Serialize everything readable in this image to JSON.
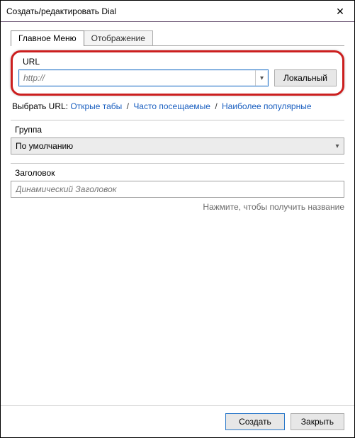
{
  "window": {
    "title": "Создать/редактировать Dial"
  },
  "tabs": {
    "main": "Главное Меню",
    "display": "Отображение"
  },
  "url_section": {
    "label": "URL",
    "placeholder": "http://",
    "local_btn": "Локальный"
  },
  "select_url": {
    "prefix": "Выбрать URL:",
    "open_tabs": "Открые табы",
    "frequent": "Часто посещаемые",
    "popular": "Наиболее популярные"
  },
  "group_section": {
    "label": "Группа",
    "value": "По умолчанию"
  },
  "title_section": {
    "label": "Заголовок",
    "placeholder": "Динамический Заголовок",
    "hint": "Нажмите, чтобы получить название"
  },
  "footer": {
    "create": "Создать",
    "close": "Закрыть"
  }
}
